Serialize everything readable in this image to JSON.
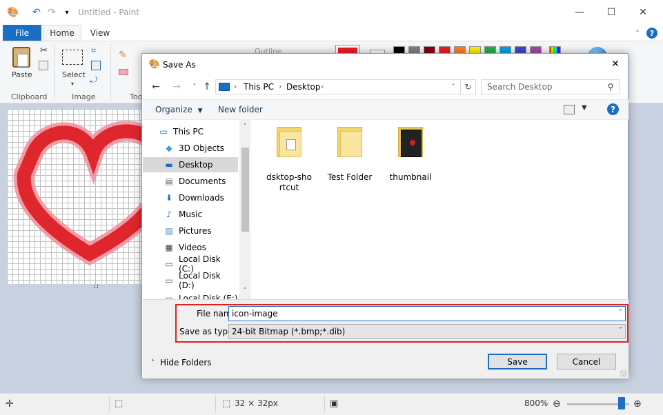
{
  "paint": {
    "title": "Untitled - Paint",
    "tabs": {
      "file": "File",
      "home": "Home",
      "view": "View"
    },
    "ribbon": {
      "paste_label": "Paste",
      "select_label": "Select",
      "outline_label": "Outline",
      "groups": {
        "clipboard": "Clipboard",
        "image": "Image",
        "tools": "Too"
      }
    },
    "palette": [
      "#000000",
      "#7f7f7f",
      "#880015",
      "#ed1c24",
      "#ff7f27",
      "#fff200",
      "#22b14c",
      "#00a2e8",
      "#3f48cc",
      "#a349a4"
    ],
    "status": {
      "canvas_size": "32 × 32px",
      "zoom": "800%"
    },
    "colors": {
      "accent": "#1a6fc4",
      "heart": "#e0262d",
      "heart_light": "#ef8a96"
    }
  },
  "dialog": {
    "title": "Save As",
    "address": {
      "root": "This PC",
      "current": "Desktop"
    },
    "search_placeholder": "Search Desktop",
    "commands": {
      "organize": "Organize",
      "new_folder": "New folder"
    },
    "nav_items": [
      {
        "label": "This PC",
        "icon": "computer-icon"
      },
      {
        "label": "3D Objects",
        "icon": "cube-icon"
      },
      {
        "label": "Desktop",
        "icon": "desktop-icon"
      },
      {
        "label": "Documents",
        "icon": "document-icon"
      },
      {
        "label": "Downloads",
        "icon": "download-icon"
      },
      {
        "label": "Music",
        "icon": "music-icon"
      },
      {
        "label": "Pictures",
        "icon": "picture-icon"
      },
      {
        "label": "Videos",
        "icon": "video-icon"
      },
      {
        "label": "Local Disk (C:)",
        "icon": "disk-icon"
      },
      {
        "label": "Local Disk (D:)",
        "icon": "disk-icon"
      },
      {
        "label": "Local Disk (E:)",
        "icon": "disk-icon"
      }
    ],
    "files": [
      {
        "label_line1": "dsktop-sho",
        "label_line2": "rtcut"
      },
      {
        "label_line1": "Test Folder",
        "label_line2": ""
      },
      {
        "label_line1": "thumbnail",
        "label_line2": ""
      }
    ],
    "file_name_label": "File name:",
    "file_name_value": "icon-image",
    "save_type_label": "Save as type:",
    "save_type_value": "24-bit Bitmap (*.bmp;*.dib)",
    "hide_folders": "Hide Folders",
    "save_button": "Save",
    "cancel_button": "Cancel",
    "colors": {
      "highlight_box": "#e02020",
      "selected_nav": "#d9d9d9"
    }
  }
}
